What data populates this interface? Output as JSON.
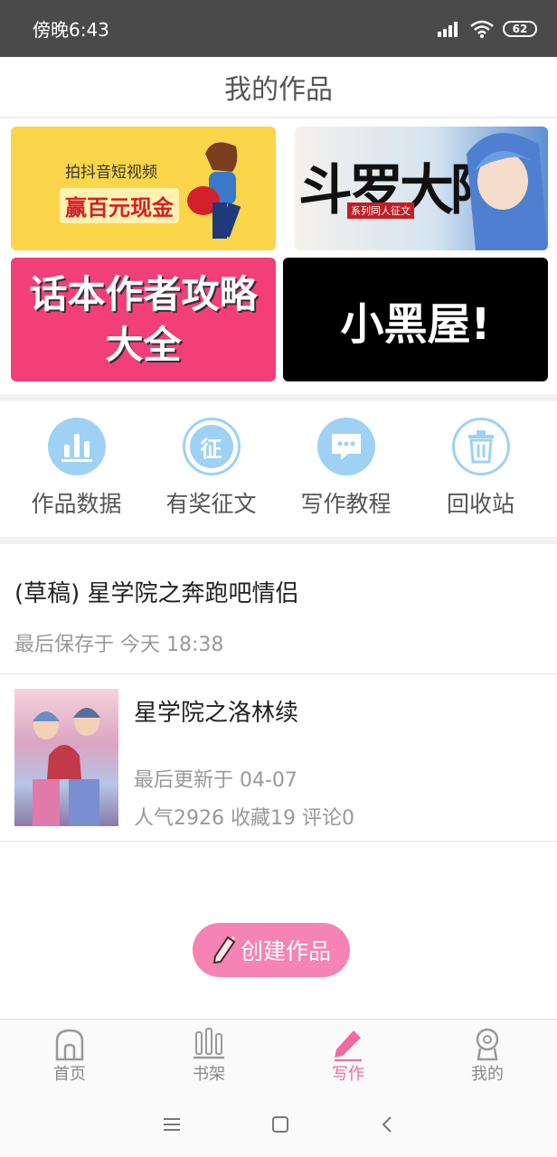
{
  "status_bar": {
    "time": "傍晚6:43",
    "battery": "62"
  },
  "header": {
    "title": "我的作品"
  },
  "banners": {
    "b1_line1": "拍抖音短视频",
    "b1_line2": "赢百元现金",
    "b2_title": "斗罗大陆",
    "b2_sub": "系列同人征文",
    "b3_line1": "话本作者攻略",
    "b3_line2": "大全",
    "b4_text": "小黑屋!"
  },
  "quick_actions": [
    {
      "label": "作品数据",
      "icon": "bar-chart-icon"
    },
    {
      "label": "有奖征文",
      "icon": "contest-icon"
    },
    {
      "label": "写作教程",
      "icon": "chat-bubble-icon"
    },
    {
      "label": "回收站",
      "icon": "trash-icon"
    }
  ],
  "draft": {
    "title": "(草稿) 星学院之奔跑吧情侣",
    "meta": "最后保存于 今天 18:38"
  },
  "work": {
    "title": "星学院之洛林续",
    "meta": "最后更新于 04-07",
    "stats": "人气2926 收藏19 评论0"
  },
  "create_button": {
    "label": "创建作品"
  },
  "tabs": [
    {
      "label": "首页",
      "icon": "home-icon"
    },
    {
      "label": "书架",
      "icon": "bookshelf-icon"
    },
    {
      "label": "写作",
      "icon": "pencil-icon"
    },
    {
      "label": "我的",
      "icon": "profile-icon"
    }
  ],
  "colors": {
    "accent": "#f06aa0",
    "icon_blue": "#9fd1f5"
  }
}
